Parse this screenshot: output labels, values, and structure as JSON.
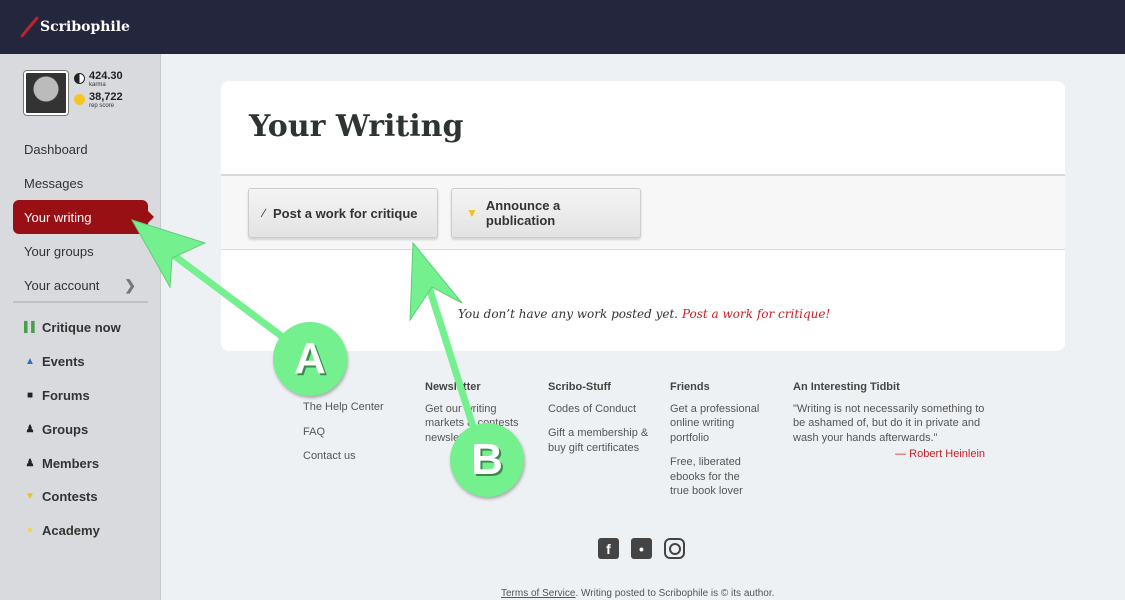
{
  "header": {
    "app_name": "Scribophile"
  },
  "profile": {
    "karma_value": "424.30",
    "karma_label": "karma",
    "rep_value": "38,722",
    "rep_label": "rep score"
  },
  "sidebar": {
    "primary": [
      {
        "label": "Dashboard"
      },
      {
        "label": "Messages"
      },
      {
        "label": "Your writing",
        "active": true
      },
      {
        "label": "Your groups"
      },
      {
        "label": "Your account",
        "icon": "chevron-right-icon"
      }
    ],
    "secondary": [
      {
        "label": "Critique now",
        "icon": "books-icon",
        "glyph": "▌",
        "color": "#4aa04a"
      },
      {
        "label": "Events",
        "icon": "graduation-cap-icon",
        "glyph": "▲",
        "color": "#2a6fc9"
      },
      {
        "label": "Forums",
        "icon": "chat-bubbles-icon",
        "glyph": "■",
        "color": "#222"
      },
      {
        "label": "Groups",
        "icon": "group-icon",
        "glyph": "●",
        "color": "#222"
      },
      {
        "label": "Members",
        "icon": "person-icon",
        "glyph": "●",
        "color": "#222"
      },
      {
        "label": "Contests",
        "icon": "trophy-icon",
        "glyph": "▼",
        "color": "#f0c020"
      },
      {
        "label": "Academy",
        "icon": "lightbulb-icon",
        "glyph": "●",
        "color": "#f4d640"
      }
    ]
  },
  "main": {
    "title": "Your Writing",
    "buttons": {
      "post": "Post a work for critique",
      "announce": "Announce a publication"
    },
    "empty_text": "You don’t have any work posted yet.",
    "empty_link": "Post a work for critique!"
  },
  "footer": {
    "help": [
      "The Help Center",
      "FAQ",
      "Contact us"
    ],
    "newsletter": {
      "heading": "Newsletter",
      "text": "Get our writing markets & contests newsletter"
    },
    "scribo": {
      "heading": "Scribo-Stuff",
      "items": [
        "Codes of Conduct",
        "Gift a membership & buy gift certificates"
      ]
    },
    "friends": {
      "heading": "Friends",
      "items": [
        "Get a professional online writing portfolio",
        "Free, liberated ebooks for the true book lover"
      ]
    },
    "tidbit": {
      "heading": "An Interesting Tidbit",
      "quote": "\"Writing is not necessarily something to be ashamed of, but do it in private and wash your hands afterwards.\"",
      "author": "— Robert Heinlein"
    },
    "legal_link": "Terms of Service",
    "legal_text": ". Writing posted to Scribophile is © its author."
  },
  "annotations": [
    {
      "label": "A"
    },
    {
      "label": "B"
    }
  ]
}
